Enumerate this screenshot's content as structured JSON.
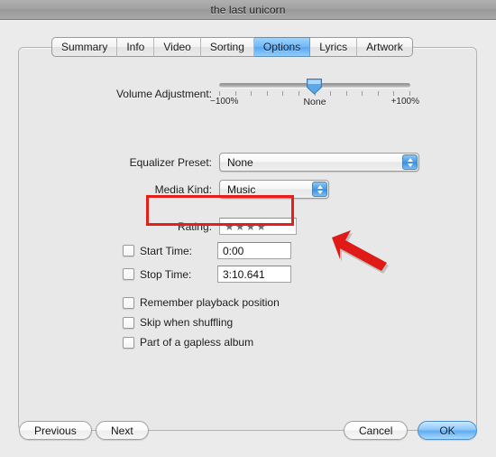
{
  "window": {
    "title": "the last unicorn"
  },
  "tabs": [
    {
      "label": "Summary",
      "active": false
    },
    {
      "label": "Info",
      "active": false
    },
    {
      "label": "Video",
      "active": false
    },
    {
      "label": "Sorting",
      "active": false
    },
    {
      "label": "Options",
      "active": true
    },
    {
      "label": "Lyrics",
      "active": false
    },
    {
      "label": "Artwork",
      "active": false
    }
  ],
  "options": {
    "volume": {
      "label": "Volume Adjustment:",
      "min_label": "−100%",
      "mid_label": "None",
      "max_label": "+100%",
      "value": "None",
      "tick_count": 13
    },
    "equalizer": {
      "label": "Equalizer Preset:",
      "value": "None"
    },
    "media_kind": {
      "label": "Media Kind:",
      "value": "Music"
    },
    "rating": {
      "label": "Rating:",
      "value": 4,
      "max": 5,
      "star_glyph": "★",
      "empty_glyph": "·",
      "highlight_color": "#e41f1c"
    },
    "start_time": {
      "label": "Start Time:",
      "value": "0:00",
      "checked": false
    },
    "stop_time": {
      "label": "Stop Time:",
      "value": "3:10.641",
      "checked": false
    },
    "checkboxes": [
      {
        "label": "Remember playback position",
        "checked": false
      },
      {
        "label": "Skip when shuffling",
        "checked": false
      },
      {
        "label": "Part of a gapless album",
        "checked": false
      }
    ]
  },
  "buttons": {
    "previous": "Previous",
    "next": "Next",
    "cancel": "Cancel",
    "ok": "OK"
  },
  "annotation": {
    "arrow_color": "#e01b17",
    "points_at": "rating-field"
  }
}
